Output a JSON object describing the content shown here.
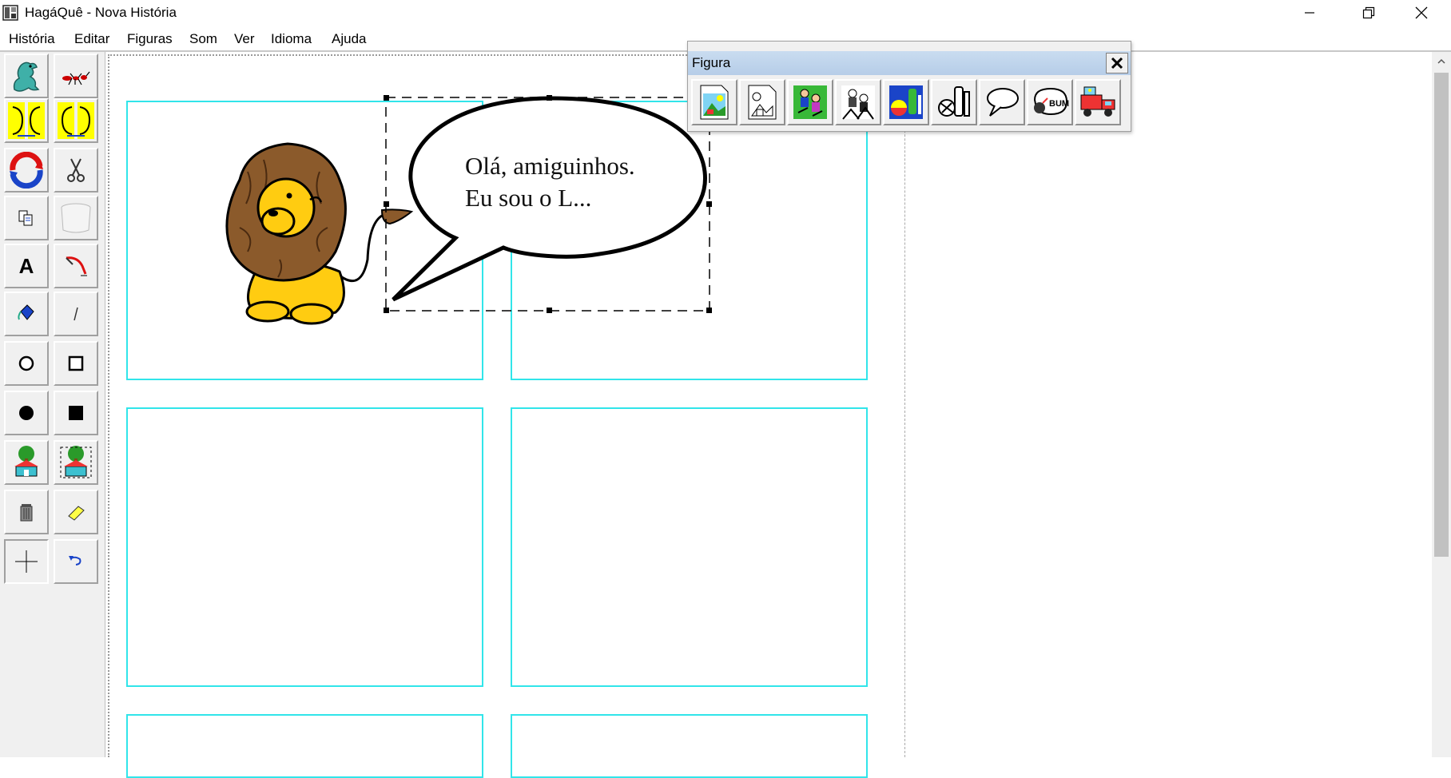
{
  "window": {
    "title": "HagáQuê - Nova História",
    "minimize_icon": "minimize-icon",
    "restore_icon": "restore-icon",
    "close_icon": "close-icon"
  },
  "menu": [
    "História",
    "Editar",
    "Figuras",
    "Som",
    "Ver",
    "Idioma",
    "Ajuda"
  ],
  "tools": [
    {
      "name": "dinosaur-icon"
    },
    {
      "name": "ant-icon"
    },
    {
      "name": "faces-flip-horizontal-icon"
    },
    {
      "name": "faces-flip-vertical-icon"
    },
    {
      "name": "rotate-icon"
    },
    {
      "name": "scissors-icon"
    },
    {
      "name": "copy-icon"
    },
    {
      "name": "paste-bin-icon"
    },
    {
      "name": "text-icon",
      "label": "A"
    },
    {
      "name": "pen-icon"
    },
    {
      "name": "paint-bucket-icon"
    },
    {
      "name": "line-icon"
    },
    {
      "name": "circle-outline-icon"
    },
    {
      "name": "square-outline-icon"
    },
    {
      "name": "circle-filled-icon"
    },
    {
      "name": "square-filled-icon"
    },
    {
      "name": "scene-icon"
    },
    {
      "name": "scene-select-icon"
    },
    {
      "name": "trash-icon"
    },
    {
      "name": "eraser-icon"
    },
    {
      "name": "crosshair-icon"
    },
    {
      "name": "undo-icon"
    }
  ],
  "speech_bubble": {
    "line1": "Olá, amiguinhos.",
    "line2": "Eu sou o L..."
  },
  "palette": {
    "title": "Figura",
    "buttons": [
      "scenery-icon",
      "scenery-outline-icon",
      "characters-icon",
      "characters-outline-icon",
      "objects-icon",
      "objects-outline-icon",
      "speech-balloon-icon",
      "onomatopoeia-icon",
      "vehicles-icon"
    ],
    "onomatopoeia_text": "BUM"
  },
  "colors": {
    "panel_border": "#31e5ea",
    "toolbar_bg": "#f0f0f0",
    "palette_title_bg": "#b6cde8"
  }
}
